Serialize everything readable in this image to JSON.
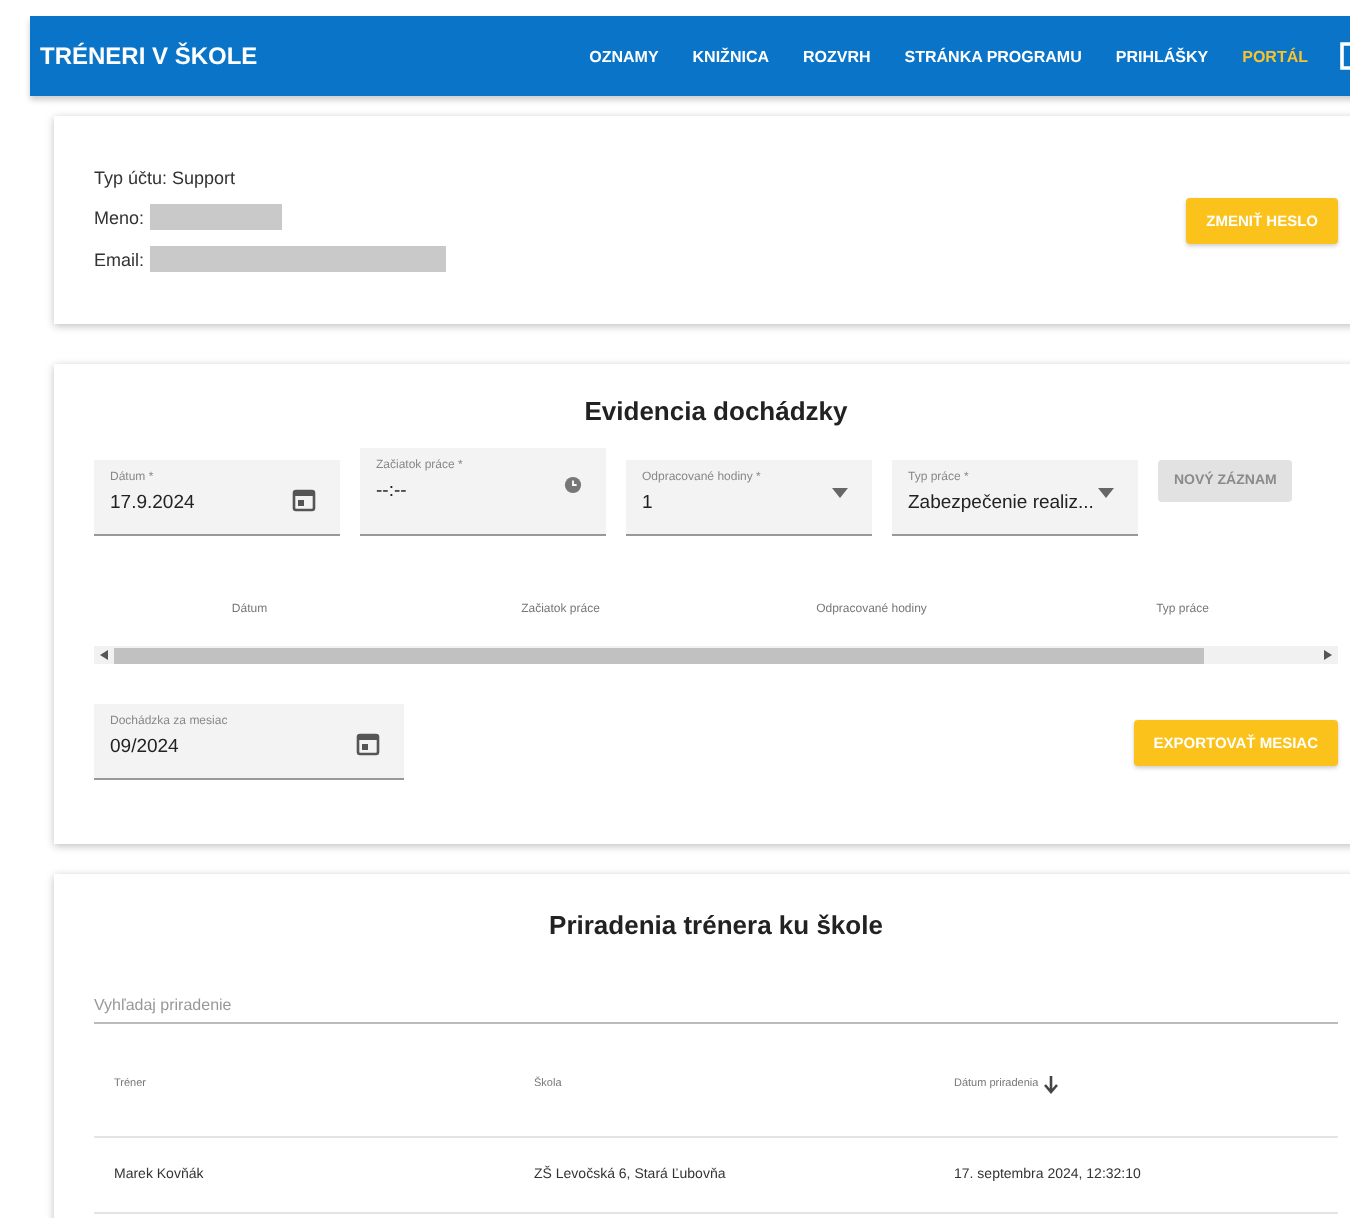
{
  "nav": {
    "brand": "TRÉNERI V ŠKOLE",
    "items": [
      {
        "label": "OZNAMY",
        "selected": false
      },
      {
        "label": "KNIŽNICA",
        "selected": false
      },
      {
        "label": "ROZVRH",
        "selected": false
      },
      {
        "label": "STRÁNKA PROGRAMU",
        "selected": false
      },
      {
        "label": "PRIHLÁŠKY",
        "selected": false
      },
      {
        "label": "PORTÁL",
        "selected": true
      }
    ]
  },
  "account": {
    "type_line": "Typ účtu: Support",
    "name_label": "Meno:",
    "email_label": "Email:",
    "change_password_button": "ZMENIŤ HESLO"
  },
  "attendance": {
    "title": "Evidencia dochádzky",
    "fields": [
      {
        "kind": "date",
        "label": "Dátum *",
        "value": "17.9.2024"
      },
      {
        "kind": "time",
        "label": "Začiatok práce *",
        "value": "--:--"
      },
      {
        "kind": "select",
        "label": "Odpracované hodiny *",
        "value": "1"
      },
      {
        "kind": "select",
        "label": "Typ práce *",
        "value": "Zabezpečenie realiz..."
      }
    ],
    "new_button": {
      "label": "NOVÝ ZÁZNAM",
      "disabled": true
    },
    "columns": [
      "Dátum",
      "Začiatok práce",
      "Odpracované hodiny",
      "Typ práce"
    ],
    "month_field": {
      "label": "Dochádzka za mesiac",
      "value": "09/2024"
    },
    "export_button": "EXPORTOVAŤ MESIAC"
  },
  "assignments": {
    "title": "Priradenia trénera ku škole",
    "search": {
      "placeholder": "Vyhľadaj priradenie"
    },
    "columns": [
      {
        "label": "Tréner",
        "sorted": false
      },
      {
        "label": "Škola",
        "sorted": false
      },
      {
        "label": "Dátum priradenia",
        "sorted": true
      }
    ],
    "rows": [
      [
        "Marek Kovňák",
        "ZŠ Levočská 6, Stará Ľubovňa",
        "17. septembra 2024, 12:32:10"
      ]
    ]
  }
}
